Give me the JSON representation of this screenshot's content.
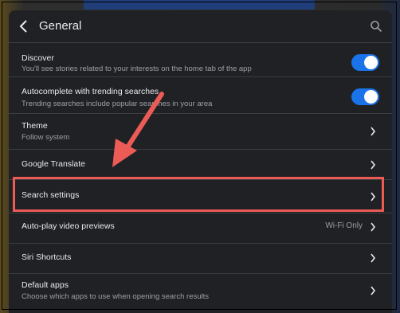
{
  "header": {
    "title": "General"
  },
  "rows": {
    "discover": {
      "title": "Discover",
      "subtitle": "You'll see stories related to your interests on the home tab of the app",
      "toggle_on": true
    },
    "autocomplete": {
      "title": "Autocomplete with trending searches",
      "subtitle": "Trending searches include popular searches in your area",
      "toggle_on": true
    },
    "theme": {
      "title": "Theme",
      "subtitle": "Follow system"
    },
    "translate": {
      "title": "Google Translate"
    },
    "search_settings": {
      "title": "Search settings"
    },
    "autoplay": {
      "title": "Auto-play video previews",
      "value": "Wi-Fi Only"
    },
    "siri": {
      "title": "Siri Shortcuts"
    },
    "default_apps": {
      "title": "Default apps",
      "subtitle": "Choose which apps to use when opening search results"
    }
  },
  "icons": {
    "back": "chevron-left-icon",
    "search": "search-icon",
    "chevron": "chevron-right-icon"
  },
  "colors": {
    "panel": "#202124",
    "toggle_on": "#1a73e8",
    "annotation": "#ec5b56"
  }
}
